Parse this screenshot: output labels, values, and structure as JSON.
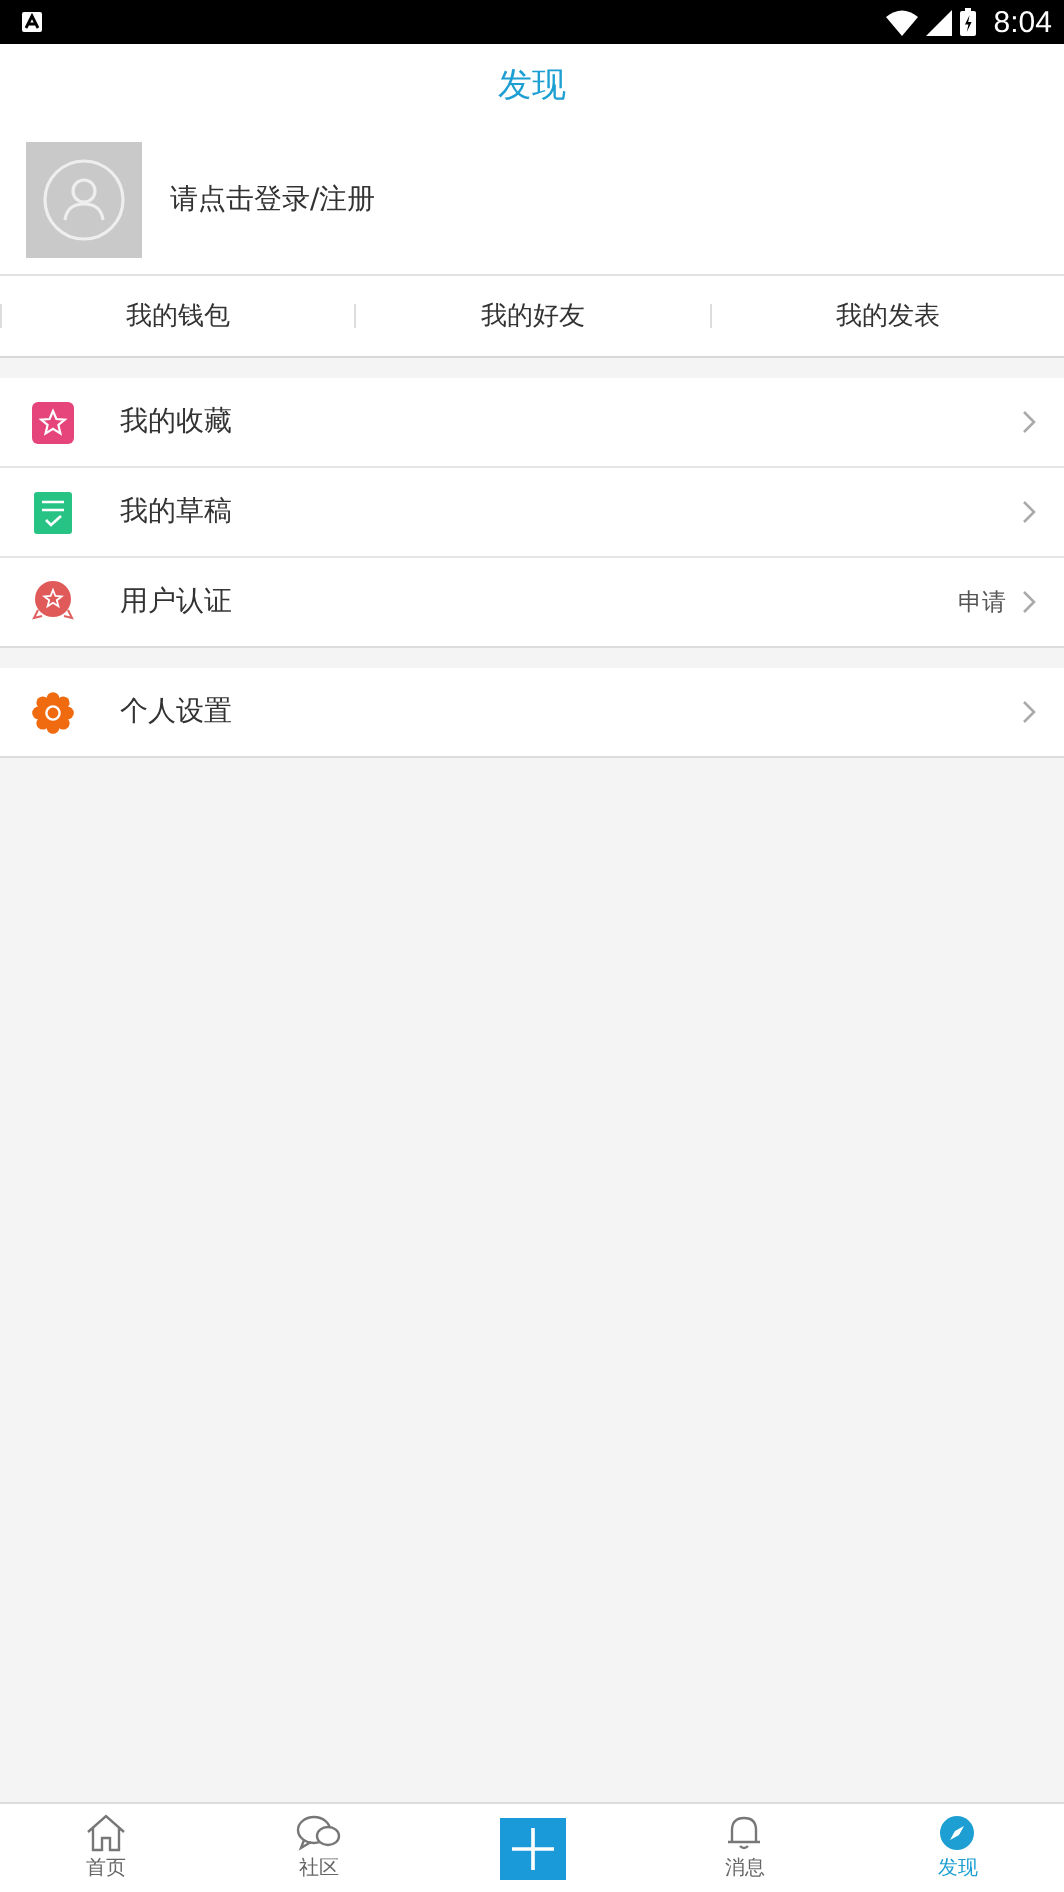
{
  "status_bar": {
    "time": "8:04"
  },
  "header": {
    "title": "发现"
  },
  "profile": {
    "prompt": "请点击登录/注册"
  },
  "quick_links": [
    "我的钱包",
    "我的好友",
    "我的发表"
  ],
  "menu_groups": [
    [
      {
        "kind": "favorites",
        "label": "我的收藏"
      },
      {
        "kind": "drafts",
        "label": "我的草稿"
      },
      {
        "kind": "verify",
        "label": "用户认证",
        "trailing": "申请"
      }
    ],
    [
      {
        "kind": "settings",
        "label": "个人设置"
      }
    ]
  ],
  "nav": [
    {
      "kind": "home",
      "label": "首页",
      "selected": false
    },
    {
      "kind": "community",
      "label": "社区",
      "selected": false
    },
    {
      "kind": "add"
    },
    {
      "kind": "messages",
      "label": "消息",
      "selected": false
    },
    {
      "kind": "discover",
      "label": "发现",
      "selected": true
    }
  ]
}
